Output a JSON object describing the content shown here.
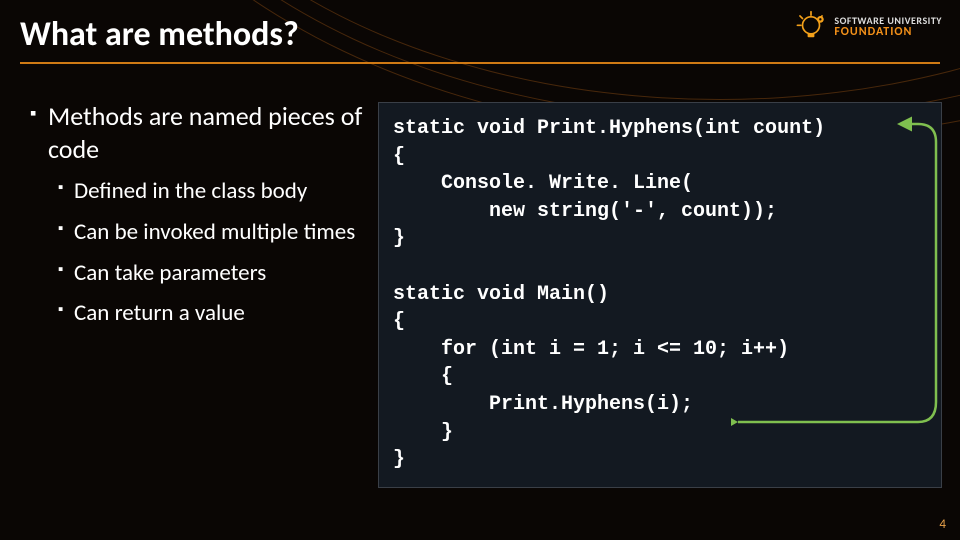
{
  "title": "What are methods?",
  "logo": {
    "line1": "SOFTWARE UNIVERSITY",
    "line2": "FOUNDATION",
    "icon": "lightbulb-gear-icon"
  },
  "bullets": {
    "main": "Methods are named pieces of code",
    "subs": [
      "Defined in the class body",
      "Can be invoked multiple times",
      "Can take parameters",
      "Can return a value"
    ]
  },
  "code": "static void Print.Hyphens(int count)\n{\n    Console. Write. Line(\n        new string('-', count));\n}\n\nstatic void Main()\n{\n    for (int i = 1; i <= 10; i++)\n    {\n        Print.Hyphens(i);\n    }\n}",
  "page_number": "4",
  "arrow": {
    "from": "Print.Hyphens(i) call",
    "to": "Print.Hyphens(int count) declaration",
    "color": "#7fbf4f"
  }
}
